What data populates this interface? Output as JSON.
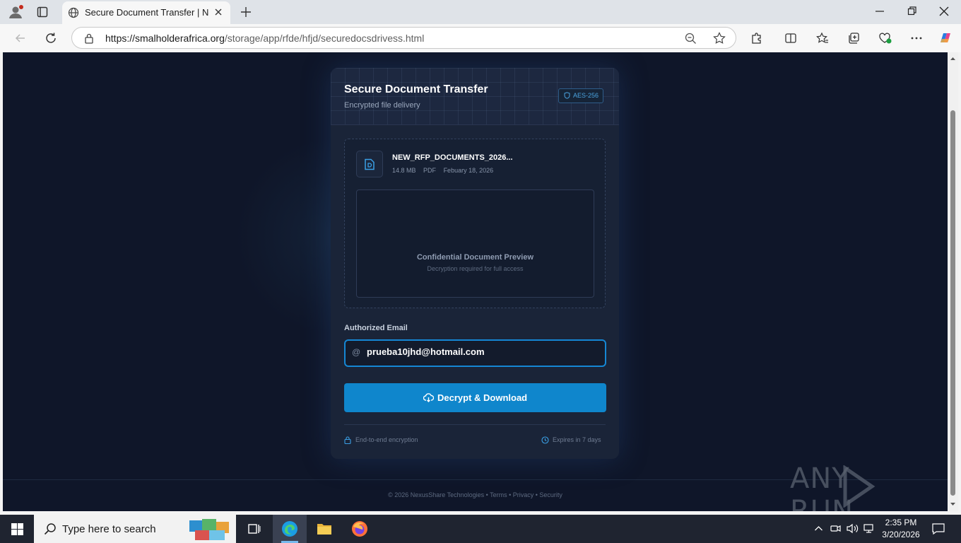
{
  "browser": {
    "tab_title": "Secure Document Transfer | NexusShare",
    "url_host": "https://smalholderafrica.org",
    "url_path": "/storage/app/rfde/hfjd/securedocsdrivess.html"
  },
  "card": {
    "title": "Secure Document Transfer",
    "subtitle": "Encrypted file delivery",
    "badge": "AES-256"
  },
  "file": {
    "name": "NEW_RFP_DOCUMENTS_2026...",
    "size": "14.8 MB",
    "type": "PDF",
    "date": "Febuary 18, 2026"
  },
  "preview": {
    "title": "Confidential Document Preview",
    "subtitle": "Decryption required for full access"
  },
  "form": {
    "email_label": "Authorized Email",
    "email_value": "prueba10jhd@hotmail.com",
    "submit_label": "Decrypt & Download"
  },
  "card_footer": {
    "encryption": "End-to-end encryption",
    "expiry": "Expires in 7 days"
  },
  "page_footer": "© 2026 NexusShare Technologies • Terms • Privacy • Security",
  "watermark": "ANY RUN",
  "taskbar": {
    "search_placeholder": "Type here to search",
    "time": "2:35 PM",
    "date": "3/20/2026"
  },
  "colors": {
    "page_bg": "#0f1629",
    "card_bg": "#1a2438",
    "accent": "#0f86cc"
  }
}
